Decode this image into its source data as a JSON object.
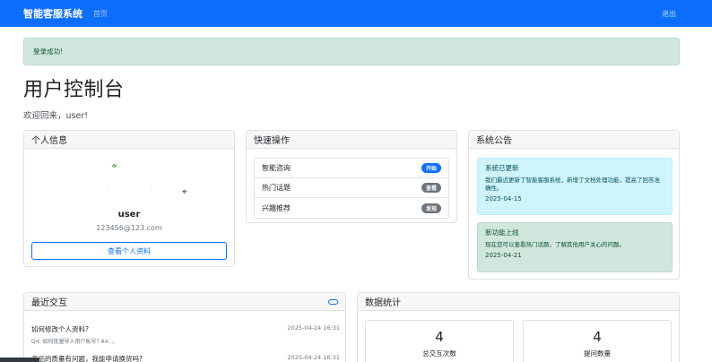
{
  "navbar": {
    "brand": "智能客服系统",
    "home": "首页",
    "logout": "退出",
    "color": "#0d6efd"
  },
  "alert": {
    "text": "登录成功!"
  },
  "page": {
    "title": "用户控制台",
    "welcome": "欢迎回来，user!"
  },
  "profile": {
    "header": "个人信息",
    "name": "user",
    "email": "123456@123.com",
    "button": "查看个人资料"
  },
  "quick": {
    "header": "快速操作",
    "items": [
      {
        "label": "智能咨询",
        "badge": "开始",
        "badge_color": "#0d6efd"
      },
      {
        "label": "热门话题",
        "badge": "查看",
        "badge_color": "#6c757d"
      },
      {
        "label": "兴趣推荐",
        "badge": "发现",
        "badge_color": "#6c757d"
      }
    ]
  },
  "announcements": {
    "header": "系统公告",
    "items": [
      {
        "title": "系统已更新",
        "body": "我们最近更新了智能客服系统，新增了文档处理功能，提高了回答准确性。",
        "date": "2025-04-15"
      },
      {
        "title": "新功能上线",
        "body": "现在您可以查看热门话题，了解其他用户关心的问题。",
        "date": "2025-04-21"
      }
    ]
  },
  "recent": {
    "header": "最近交互",
    "items": [
      {
        "question": "如何修改个人资料?",
        "answer": "Q4: 如何批量导入用户账号? A4:...",
        "time": "2025-04-24 16:31"
      },
      {
        "question": "商品的质量有问题，我能申请换货吗?",
        "answer": "",
        "time": "2025-04-24 16:31"
      }
    ]
  },
  "stats": {
    "header": "数据统计",
    "items": [
      {
        "value": "4",
        "label": "总交互次数"
      },
      {
        "value": "4",
        "label": "提问数量"
      }
    ]
  }
}
